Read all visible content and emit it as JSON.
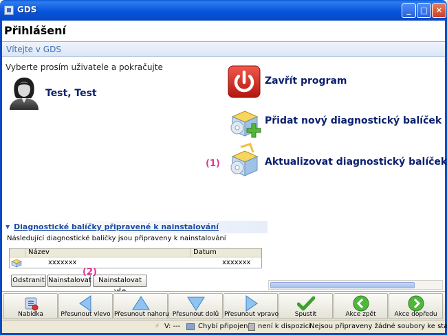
{
  "window": {
    "title": "GDS"
  },
  "page": {
    "title": "Přihlášení",
    "welcome": "Vítejte v GDS"
  },
  "users": {
    "prompt": "Vyberte prosím uživatele a pokračujte",
    "items": [
      {
        "name": "Test, Test"
      }
    ]
  },
  "actions": {
    "close_program": "Zavřít program",
    "add_package": "Přidat nový diagnostický balíček",
    "update_package": "Aktualizovat diagnostický balíček"
  },
  "annotations": {
    "a1": "(1)",
    "a2": "(2)"
  },
  "packages": {
    "title": "Diagnostické balíčky připravené k nainstalování",
    "description": "Následující diagnostické balíčky jsou připraveny k nainstalování",
    "columns": [
      "Název",
      "Datum"
    ],
    "rows": [
      {
        "name": "xxxxxxx",
        "date": "xxxxxxx"
      }
    ],
    "buttons": {
      "remove": "Odstranit",
      "install": "Nainstalovat",
      "install_all": "Nainstalovat vše"
    }
  },
  "toolbar": {
    "menu": "Nabídka",
    "move_left": "Přesunout vlevo",
    "move_up": "Přesunout nahoru",
    "move_down": "Přesunout dolů",
    "move_right": "Přesunout vpravo",
    "run": "Spustit",
    "back": "Akce zpět",
    "forward": "Akce dopředu"
  },
  "status": {
    "v": "V: ---",
    "connection": "Chybí připojení",
    "availability": "není k dispozici",
    "files": "Nejsou připraveny žádné soubory ke stažení"
  },
  "colors": {
    "title_bar": "#0855dd",
    "heading_text": "#0a1f6e",
    "annotation": "#e0359a",
    "welcome_text": "#3d6fb8"
  },
  "icons": [
    "app-icon",
    "minimize-icon",
    "maximize-icon",
    "close-icon",
    "user-avatar-icon",
    "power-icon",
    "add-package-icon",
    "update-package-icon",
    "package-row-icon",
    "menu-icon",
    "arrow-left-icon",
    "arrow-up-icon",
    "arrow-down-icon",
    "arrow-right-icon",
    "checkmark-icon",
    "back-icon",
    "forward-icon",
    "lightning-icon",
    "connection-icon",
    "disk-icon"
  ]
}
